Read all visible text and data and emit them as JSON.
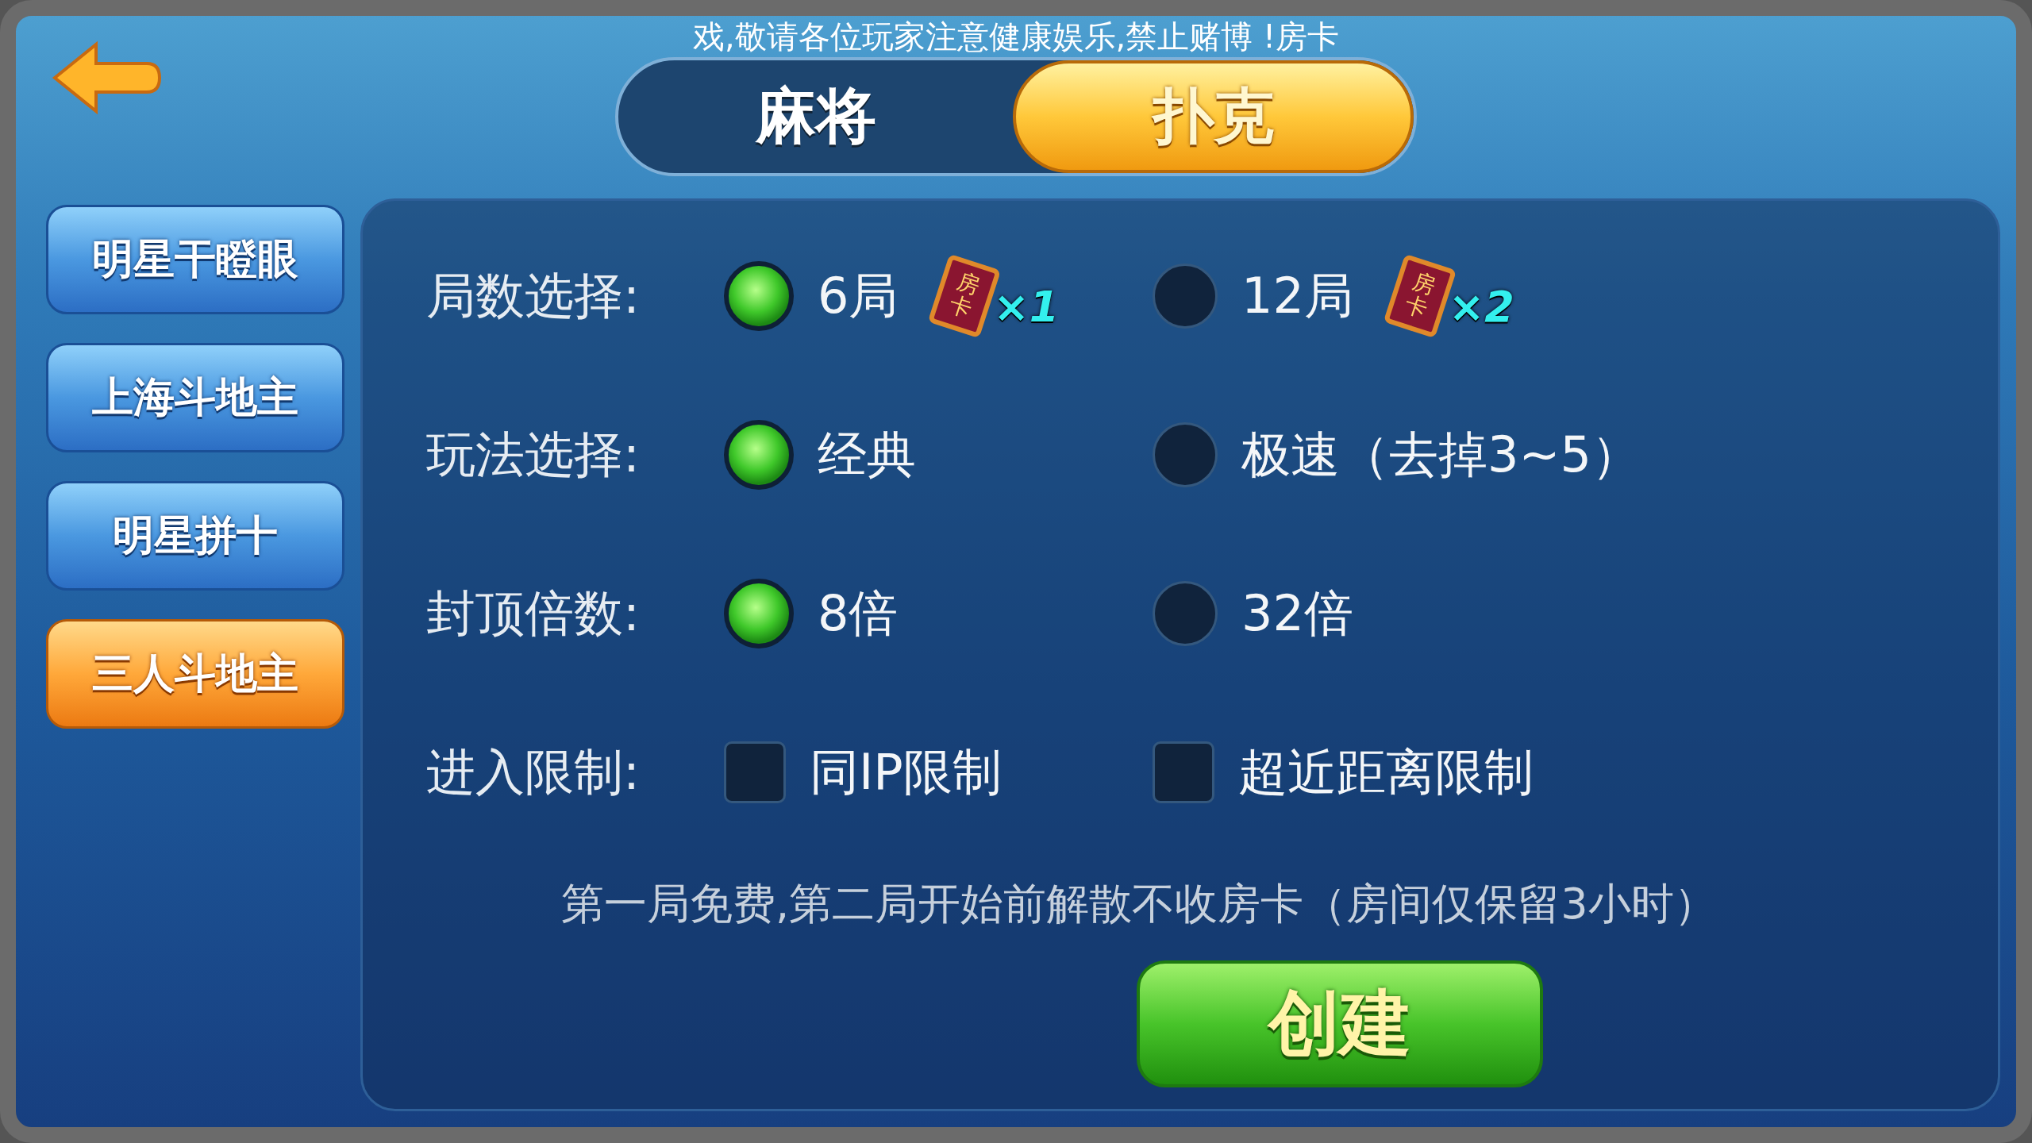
{
  "marquee": "戏,敬请各位玩家注意健康娱乐,禁止赌博 !房卡",
  "category_tabs": [
    {
      "label": "麻将",
      "selected": false
    },
    {
      "label": "扑克",
      "selected": true
    }
  ],
  "games": [
    {
      "label": "明星干瞪眼",
      "selected": false
    },
    {
      "label": "上海斗地主",
      "selected": false
    },
    {
      "label": "明星拼十",
      "selected": false
    },
    {
      "label": "三人斗地主",
      "selected": true
    }
  ],
  "options": [
    {
      "label": "局数选择:",
      "kind": "radio",
      "choices": [
        {
          "label": "6局",
          "selected": true,
          "cost": {
            "card": "房卡",
            "count": "×1"
          }
        },
        {
          "label": "12局",
          "selected": false,
          "cost": {
            "card": "房卡",
            "count": "×2"
          }
        }
      ]
    },
    {
      "label": "玩法选择:",
      "kind": "radio",
      "choices": [
        {
          "label": "经典",
          "selected": true
        },
        {
          "label": "极速（去掉3~5）",
          "selected": false
        }
      ]
    },
    {
      "label": "封顶倍数:",
      "kind": "radio",
      "choices": [
        {
          "label": "8倍",
          "selected": true
        },
        {
          "label": "32倍",
          "selected": false
        }
      ]
    },
    {
      "label": "进入限制:",
      "kind": "checkbox",
      "choices": [
        {
          "label": "同IP限制",
          "checked": false
        },
        {
          "label": "超近距离限制",
          "checked": false
        }
      ]
    }
  ],
  "note": "第一局免费,第二局开始前解散不收房卡（房间仅保留3小时）",
  "create_button": "创建"
}
